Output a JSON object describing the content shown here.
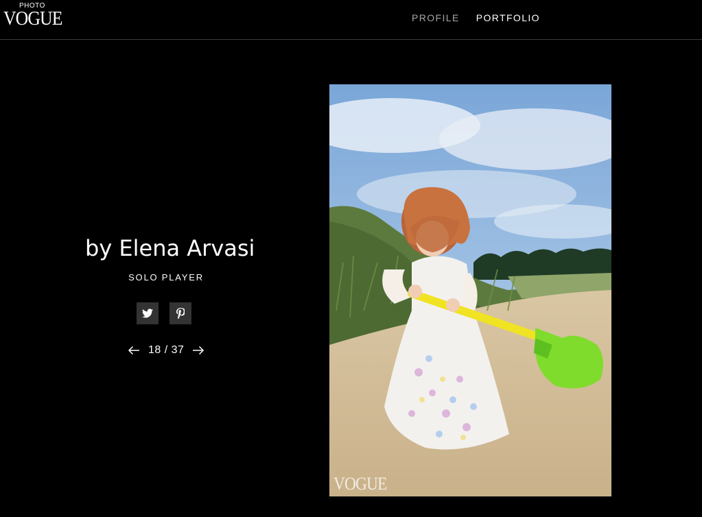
{
  "header": {
    "logo_small": "PHOTO",
    "logo_big": "VOGUE",
    "nav": [
      {
        "label": "PROFILE",
        "active": false
      },
      {
        "label": "PORTFOLIO",
        "active": true
      }
    ]
  },
  "photo_info": {
    "credit": "by Elena Arvasi",
    "title": "SOLO PLAYER",
    "share": [
      {
        "icon": "twitter-icon"
      },
      {
        "icon": "pinterest-icon"
      }
    ],
    "pager": {
      "current": "18",
      "separator": "/",
      "total": "37",
      "label": "18 / 37"
    }
  },
  "photo": {
    "watermark": "VOGUE",
    "description_icon": "photo"
  },
  "colors": {
    "background": "#000000",
    "nav_inactive": "#a8a8a8",
    "nav_active": "#ffffff",
    "share_bg": "#333333",
    "divider": "#3a3a3a"
  }
}
